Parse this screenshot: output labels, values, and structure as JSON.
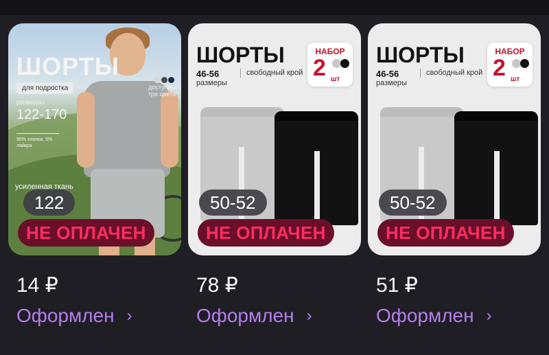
{
  "cards": [
    {
      "size_label": "122",
      "status": "НЕ ОПЛАЧЕН",
      "price": "14 ₽",
      "state": "Оформлен",
      "photo": {
        "title": "ШОРТЫ",
        "tag1": "для подростка",
        "sizes_label": "размеры",
        "sizes": "122-170",
        "fabric": "95% хлопок, 5% лайкра",
        "colors": "доступны три цвета",
        "footer": "усиленная ткань"
      }
    },
    {
      "size_label": "50-52",
      "status": "НЕ ОПЛАЧЕН",
      "price": "78 ₽",
      "state": "Оформлен",
      "photo": {
        "title": "ШОРТЫ",
        "sizes": "46-56",
        "sizes_label": "размеры",
        "fit": "свободный крой",
        "badge_top": "НАБОР",
        "badge_num": "2",
        "badge_unit": "шт"
      }
    },
    {
      "size_label": "50-52",
      "status": "НЕ ОПЛАЧЕН",
      "price": "51 ₽",
      "state": "Оформлен",
      "photo": {
        "title": "ШОРТЫ",
        "sizes": "46-56",
        "sizes_label": "размеры",
        "fit": "свободный крой",
        "badge_top": "НАБОР",
        "badge_num": "2",
        "badge_unit": "шт"
      }
    }
  ],
  "icons": {
    "chevron": "›"
  },
  "colors": {
    "background": "#1f1e25",
    "status_text": "#ff2d62",
    "status_bg": "#6a0f2a",
    "state_link": "#b57dea"
  }
}
